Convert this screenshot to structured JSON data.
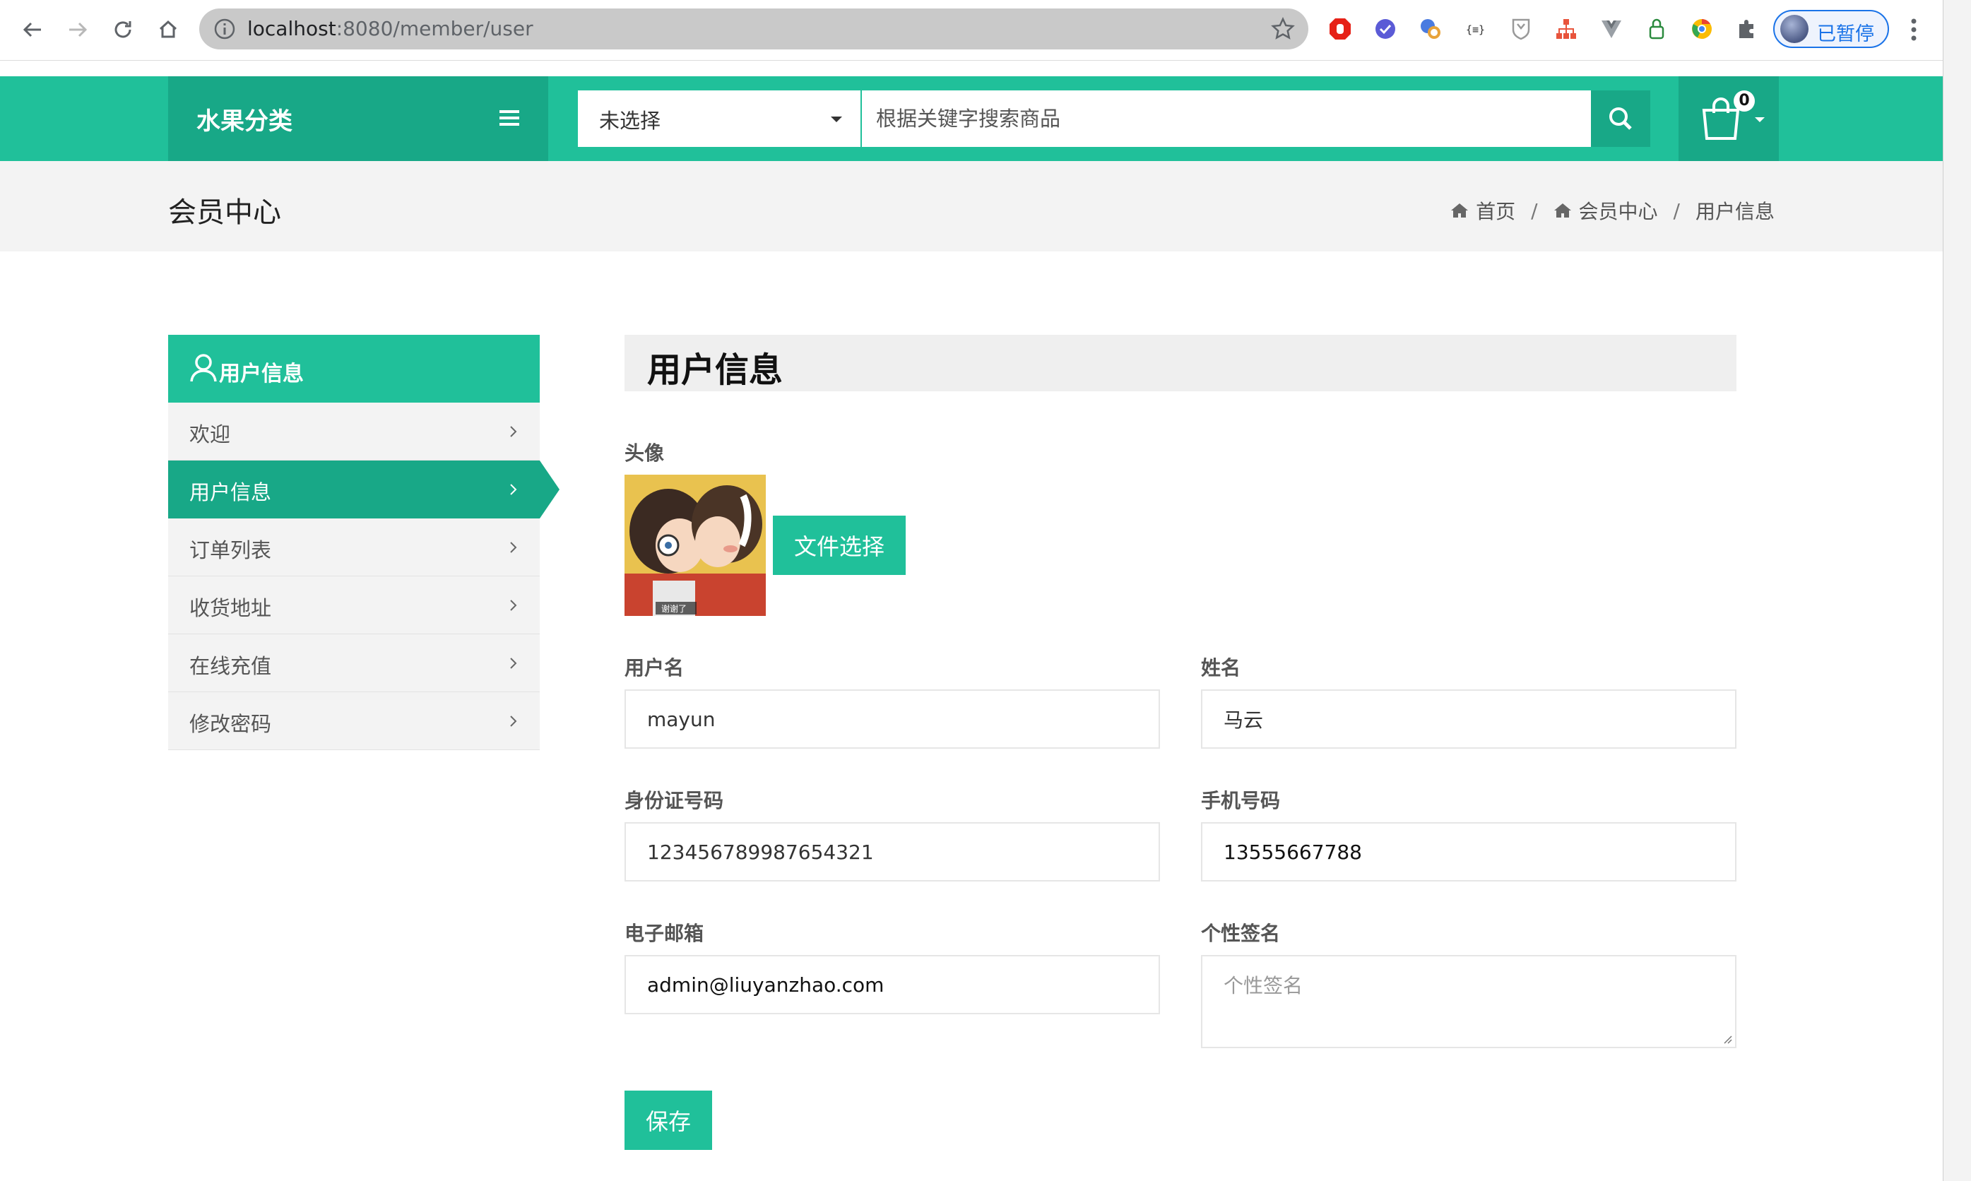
{
  "browser": {
    "url_host": "localhost",
    "url_path": ":8080/member/user",
    "profile_status": "已暂停"
  },
  "header": {
    "brand": "水果分类",
    "category_select": "未选择",
    "search_placeholder": "根据关键字搜索商品",
    "cart_count": "0",
    "accent_color": "#20c09a",
    "accent_dark": "#18a887"
  },
  "band": {
    "title": "会员中心",
    "breadcrumbs": [
      "首页",
      "会员中心",
      "用户信息"
    ],
    "separator": "/"
  },
  "sidebar": {
    "heading": "用户信息",
    "items": [
      {
        "label": "欢迎",
        "active": false
      },
      {
        "label": "用户信息",
        "active": true
      },
      {
        "label": "订单列表",
        "active": false
      },
      {
        "label": "收货地址",
        "active": false
      },
      {
        "label": "在线充值",
        "active": false
      },
      {
        "label": "修改密码",
        "active": false
      }
    ]
  },
  "form": {
    "section_title": "用户信息",
    "avatar_label": "头像",
    "avatar_caption": "谢谢了",
    "file_button": "文件选择",
    "username_label": "用户名",
    "username_value": "mayun",
    "realname_label": "姓名",
    "realname_value": "马云",
    "idcard_label": "身份证号码",
    "idcard_value": "123456789987654321",
    "phone_label": "手机号码",
    "phone_value": "13555667788",
    "email_label": "电子邮箱",
    "email_value": "admin@liuyanzhao.com",
    "signature_label": "个性签名",
    "signature_placeholder": "个性签名",
    "save_button": "保存"
  }
}
